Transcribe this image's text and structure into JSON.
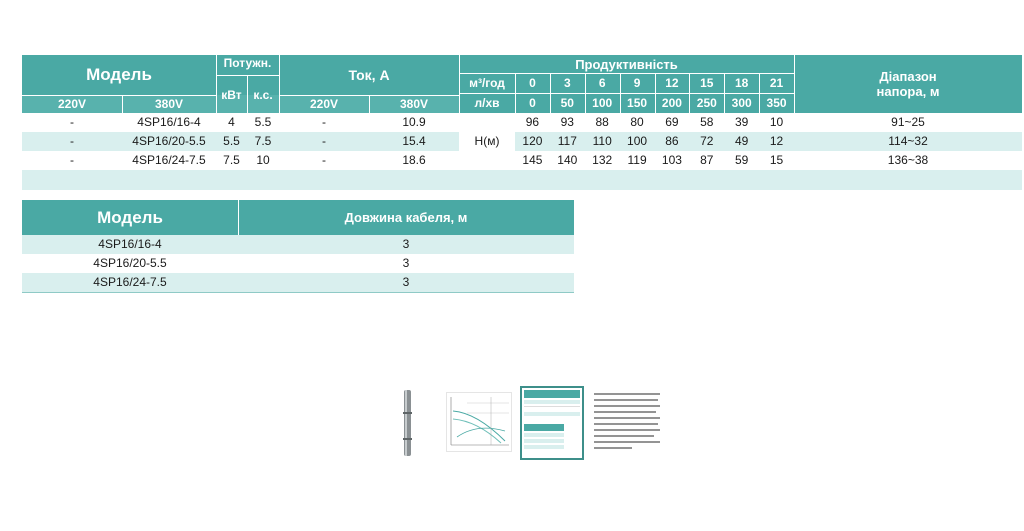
{
  "table1": {
    "header": {
      "model": "Модель",
      "power": "Потужн.",
      "kw": "кВт",
      "hp": "к.с.",
      "current": "Ток, А",
      "productivity": "Продуктивність",
      "range": "Діапазон напора, м",
      "v220": "220V",
      "v380": "380V",
      "flow_m3": "м³/год",
      "flow_l": "л/хв",
      "flow_m3_values": [
        "0",
        "3",
        "6",
        "9",
        "12",
        "15",
        "18",
        "21"
      ],
      "flow_l_values": [
        "0",
        "50",
        "100",
        "150",
        "200",
        "250",
        "300",
        "350"
      ]
    },
    "head_label": "H(м)",
    "rows": [
      {
        "v220": "-",
        "model": "4SP16/16-4",
        "kw": "4",
        "hp": "5.5",
        "a220": "-",
        "a380": "10.9",
        "heads": [
          "96",
          "93",
          "88",
          "80",
          "69",
          "58",
          "39",
          "10"
        ],
        "range": "91~25"
      },
      {
        "v220": "-",
        "model": "4SP16/20-5.5",
        "kw": "5.5",
        "hp": "7.5",
        "a220": "-",
        "a380": "15.4",
        "heads": [
          "120",
          "117",
          "110",
          "100",
          "86",
          "72",
          "49",
          "12"
        ],
        "range": "114~32"
      },
      {
        "v220": "-",
        "model": "4SP16/24-7.5",
        "kw": "7.5",
        "hp": "10",
        "a220": "-",
        "a380": "18.6",
        "heads": [
          "145",
          "140",
          "132",
          "119",
          "103",
          "87",
          "59",
          "15"
        ],
        "range": "136~38"
      }
    ]
  },
  "table2": {
    "header": {
      "model": "Модель",
      "cable": "Довжина кабеля, м"
    },
    "rows": [
      {
        "model": "4SP16/16-4",
        "cable": "3"
      },
      {
        "model": "4SP16/20-5.5",
        "cable": "3"
      },
      {
        "model": "4SP16/24-7.5",
        "cable": "3"
      }
    ]
  },
  "colors": {
    "header": "#4aa9a4",
    "row_light": "#d9efee",
    "accent_line": "#8fcac6"
  }
}
